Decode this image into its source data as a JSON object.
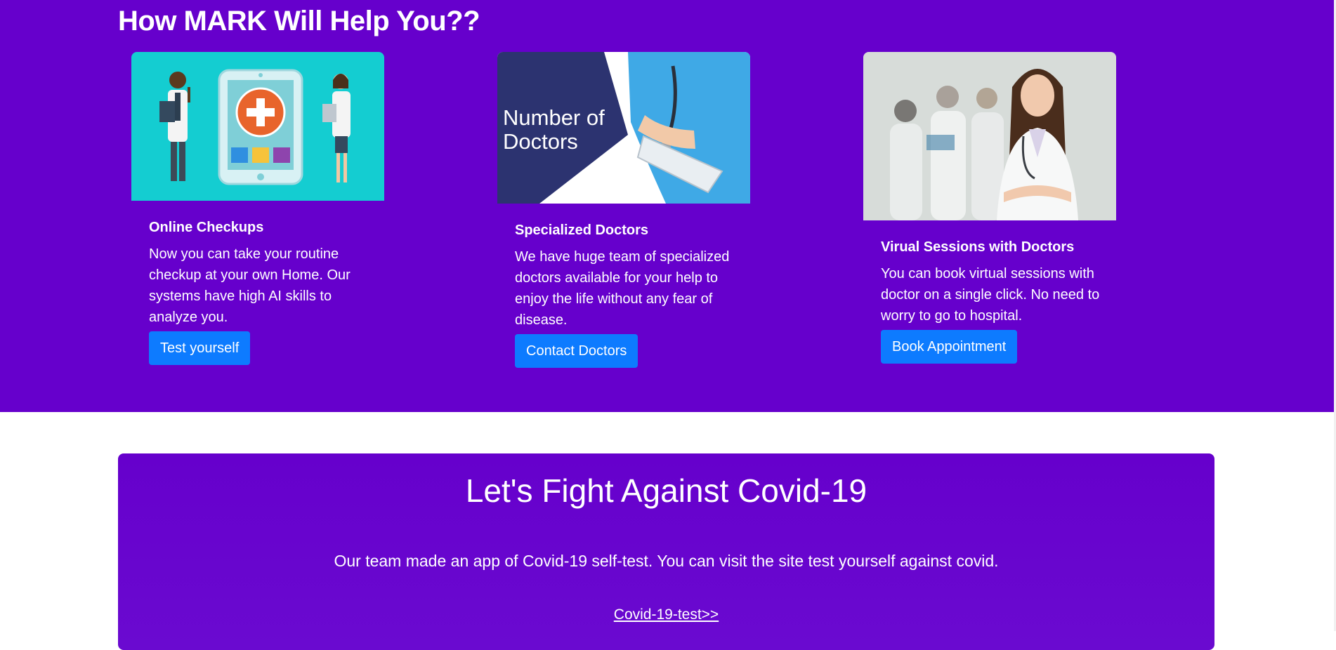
{
  "section": {
    "title": "How MARK Will Help You??"
  },
  "cards": [
    {
      "image": "online-checkup-illustration",
      "title": "Online Checkups",
      "text": "Now you can take your routine checkup at your own Home. Our systems have high AI skills to analyze you.",
      "button": "Test yourself"
    },
    {
      "image": "number-of-doctors-photo",
      "image_caption": "Number of Doctors",
      "title": "Specialized Doctors",
      "text": "We have huge team of specialized doctors available for your help to enjoy the life without any fear of disease.",
      "button": "Contact Doctors"
    },
    {
      "image": "doctors-team-photo",
      "title": "Virual Sessions with Doctors",
      "text": "You can book virtual sessions with doctor on a single click. No need to worry to go to hospital.",
      "button": "Book Appointment"
    }
  ],
  "covid": {
    "title": "Let's Fight Against Covid-19",
    "text": "Our team made an app of Covid-19 self-test. You can visit the site test yourself against covid.",
    "link": "Covid-19-test>>"
  },
  "colors": {
    "section_bg": "#6600cc",
    "button_bg": "#0d7bff",
    "page_bg": "#ffffff"
  }
}
